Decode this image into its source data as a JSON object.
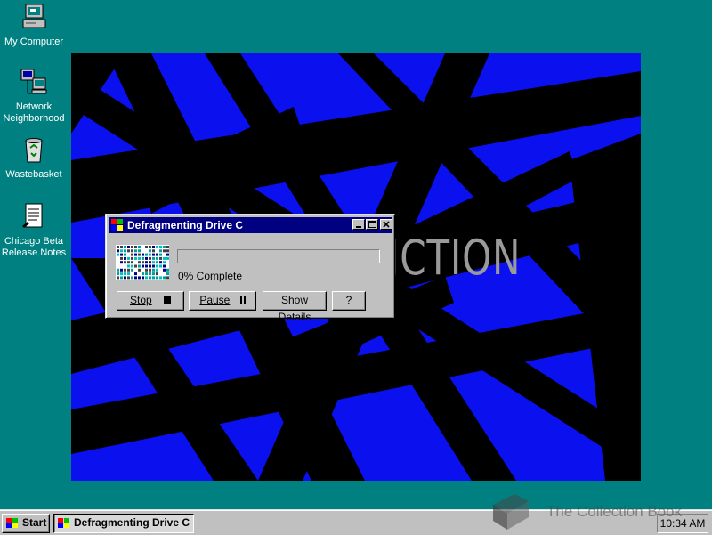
{
  "desktop": {
    "icons": [
      {
        "label": "My Computer",
        "icon": "my-computer-icon"
      },
      {
        "label": "Network\nNeighborhood",
        "icon": "network-neighborhood-icon"
      },
      {
        "label": "Wastebasket",
        "icon": "wastebasket-icon"
      },
      {
        "label": "Chicago Beta\nRelease Notes",
        "icon": "release-notes-icon"
      }
    ],
    "wallpaper_text": "JCTION"
  },
  "dialog": {
    "title": "Defragmenting Drive C",
    "progress_percent": 0,
    "status": "0% Complete",
    "buttons": {
      "stop": "Stop",
      "pause": "Pause",
      "details": "Show Details",
      "help": "?"
    }
  },
  "taskbar": {
    "start_label": "Start",
    "task_label": "Defragmenting Drive C",
    "clock": "10:34 AM"
  },
  "watermark": "The Collection Book",
  "colors": {
    "desktop": "#008080",
    "titlebar": "#000080",
    "wallpaper": "#0a10ee"
  }
}
